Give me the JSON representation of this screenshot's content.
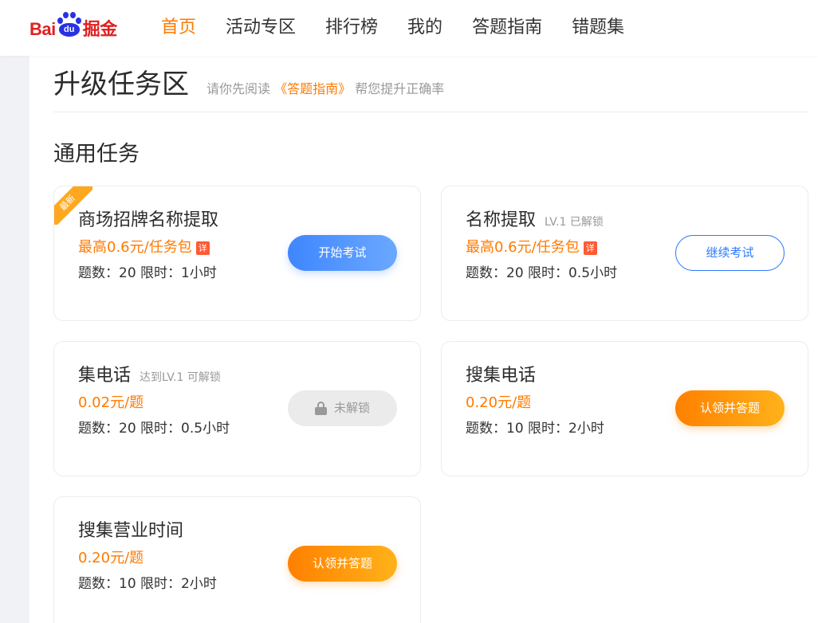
{
  "logo": {
    "part1": "Bai",
    "part2": "du",
    "part3": "掘金"
  },
  "nav": {
    "items": [
      {
        "label": "首页",
        "active": true
      },
      {
        "label": "活动专区"
      },
      {
        "label": "排行榜"
      },
      {
        "label": "我的"
      },
      {
        "label": "答题指南"
      },
      {
        "label": "错题集"
      }
    ]
  },
  "header": {
    "title": "升级任务区",
    "hint_before": "请你先阅读",
    "hint_link": "《答题指南》",
    "hint_after": "帮您提升正确率"
  },
  "section": {
    "title": "通用任务"
  },
  "tasks": [
    {
      "ribbon": "最新",
      "title": "商场招牌名称提取",
      "level": "",
      "price": "最高0.6元/任务包",
      "price_tag": "详",
      "meta": "题数：20 限时：1小时",
      "button": "开始考试",
      "button_style": "blue"
    },
    {
      "title": "名称提取",
      "level": "LV.1 已解锁",
      "price": "最高0.6元/任务包",
      "price_tag": "详",
      "meta": "题数：20 限时：0.5小时",
      "button": "继续考试",
      "button_style": "outline"
    },
    {
      "title": "集电话",
      "level": "达到LV.1 可解锁",
      "price": "0.02元/题",
      "meta": "题数：20 限时：0.5小时",
      "button": "未解锁",
      "button_style": "locked",
      "button_icon": "lock-icon"
    },
    {
      "title": "搜集电话",
      "level": "",
      "price": "0.20元/题",
      "meta": "题数：10 限时：2小时",
      "button": "认领并答题",
      "button_style": "orange"
    },
    {
      "title": "搜集营业时间",
      "level": "",
      "price": "0.20元/题",
      "meta": "题数：10 限时：2小时",
      "button": "认领并答题",
      "button_style": "orange"
    }
  ],
  "colors": {
    "accent": "#ff7a00",
    "primary_blue": "#3f86ff",
    "logo_red": "#e02020",
    "logo_blue": "#2932e1"
  }
}
